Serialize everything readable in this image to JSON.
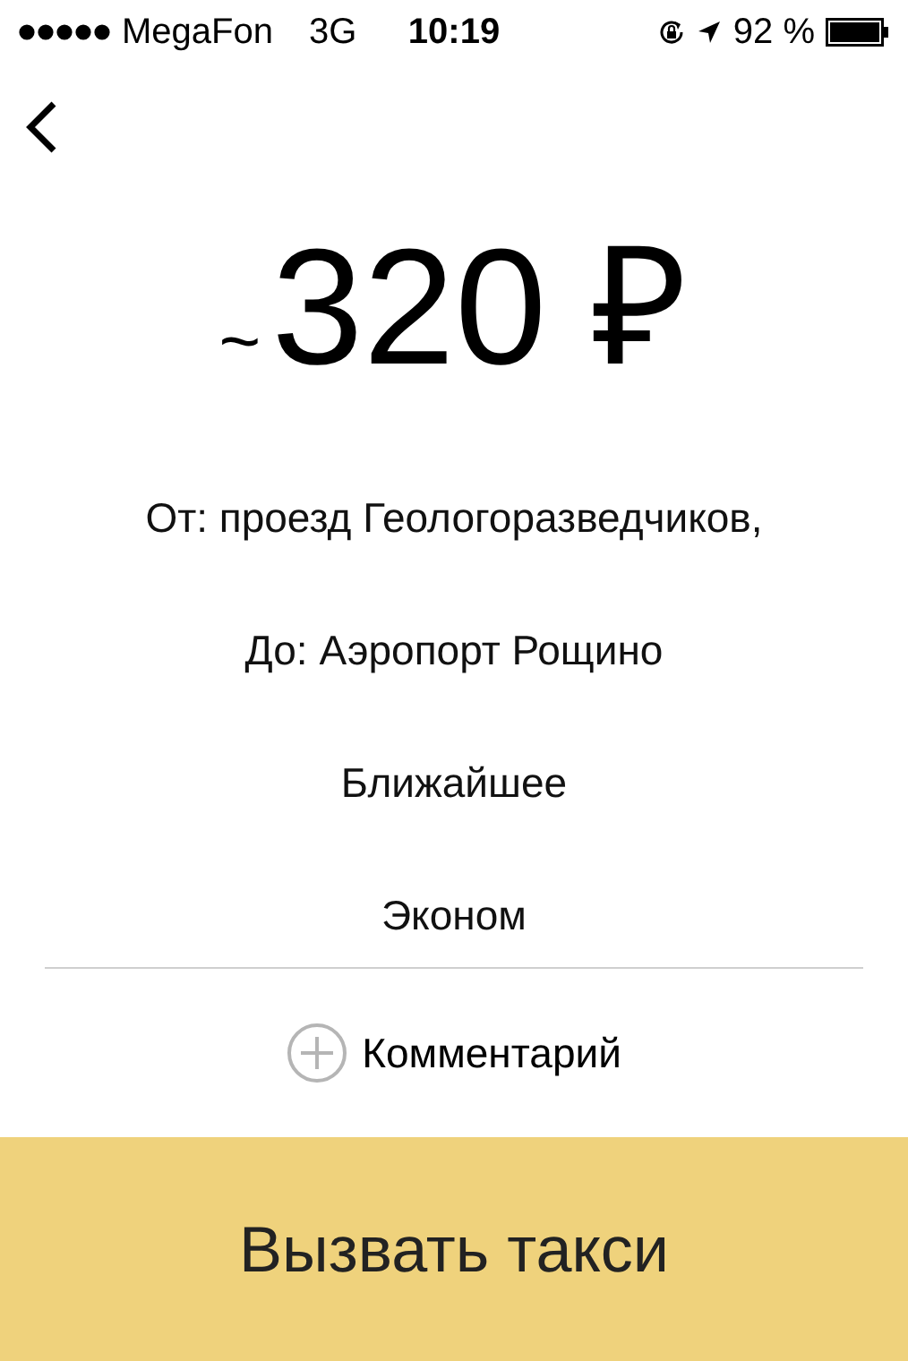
{
  "status_bar": {
    "carrier": "MegaFon",
    "network": "3G",
    "time": "10:19",
    "battery": "92 %"
  },
  "price": {
    "approx": "~",
    "amount": "320 ₽"
  },
  "details": [
    "От: проезд Геологоразведчиков,",
    "До: Аэропорт Рощино",
    "Ближайшее",
    "Эконом"
  ],
  "comment": {
    "label": "Комментарий"
  },
  "order_button": {
    "label": "Вызвать такси"
  }
}
